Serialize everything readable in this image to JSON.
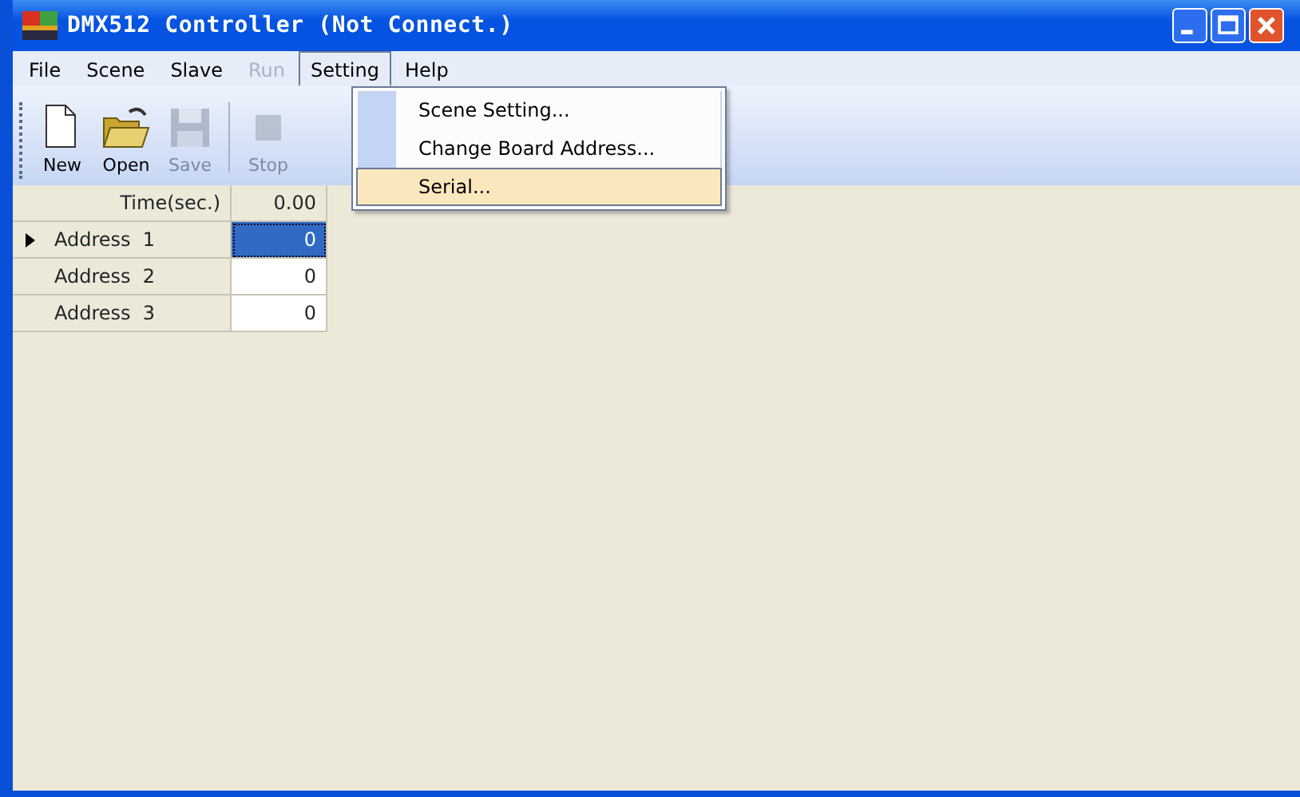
{
  "window": {
    "title": "DMX512 Controller (Not Connect.)"
  },
  "menu": [
    {
      "label": "File",
      "disabled": false,
      "selected": false
    },
    {
      "label": "Scene",
      "disabled": false,
      "selected": false
    },
    {
      "label": "Slave",
      "disabled": false,
      "selected": false
    },
    {
      "label": "Run",
      "disabled": true,
      "selected": false
    },
    {
      "label": "Setting",
      "disabled": false,
      "selected": true
    },
    {
      "label": "Help",
      "disabled": false,
      "selected": false
    }
  ],
  "dropdown": [
    {
      "label": "Scene Setting...",
      "selected": false
    },
    {
      "label": "Change Board Address...",
      "selected": false
    },
    {
      "label": "Serial...",
      "selected": true
    }
  ],
  "toolbar": [
    {
      "label": "New",
      "kind": "new",
      "disabled": false
    },
    {
      "label": "Open",
      "kind": "open",
      "disabled": false
    },
    {
      "label": "Save",
      "kind": "save",
      "disabled": true
    },
    {
      "label": "Stop",
      "kind": "stop",
      "disabled": true
    }
  ],
  "grid": {
    "header": [
      "Time(sec.)",
      "0.00"
    ],
    "rows": [
      {
        "label": "Address  1",
        "value": "0",
        "selected": true
      },
      {
        "label": "Address  2",
        "value": "0",
        "selected": false
      },
      {
        "label": "Address  3",
        "value": "0",
        "selected": false
      }
    ]
  }
}
